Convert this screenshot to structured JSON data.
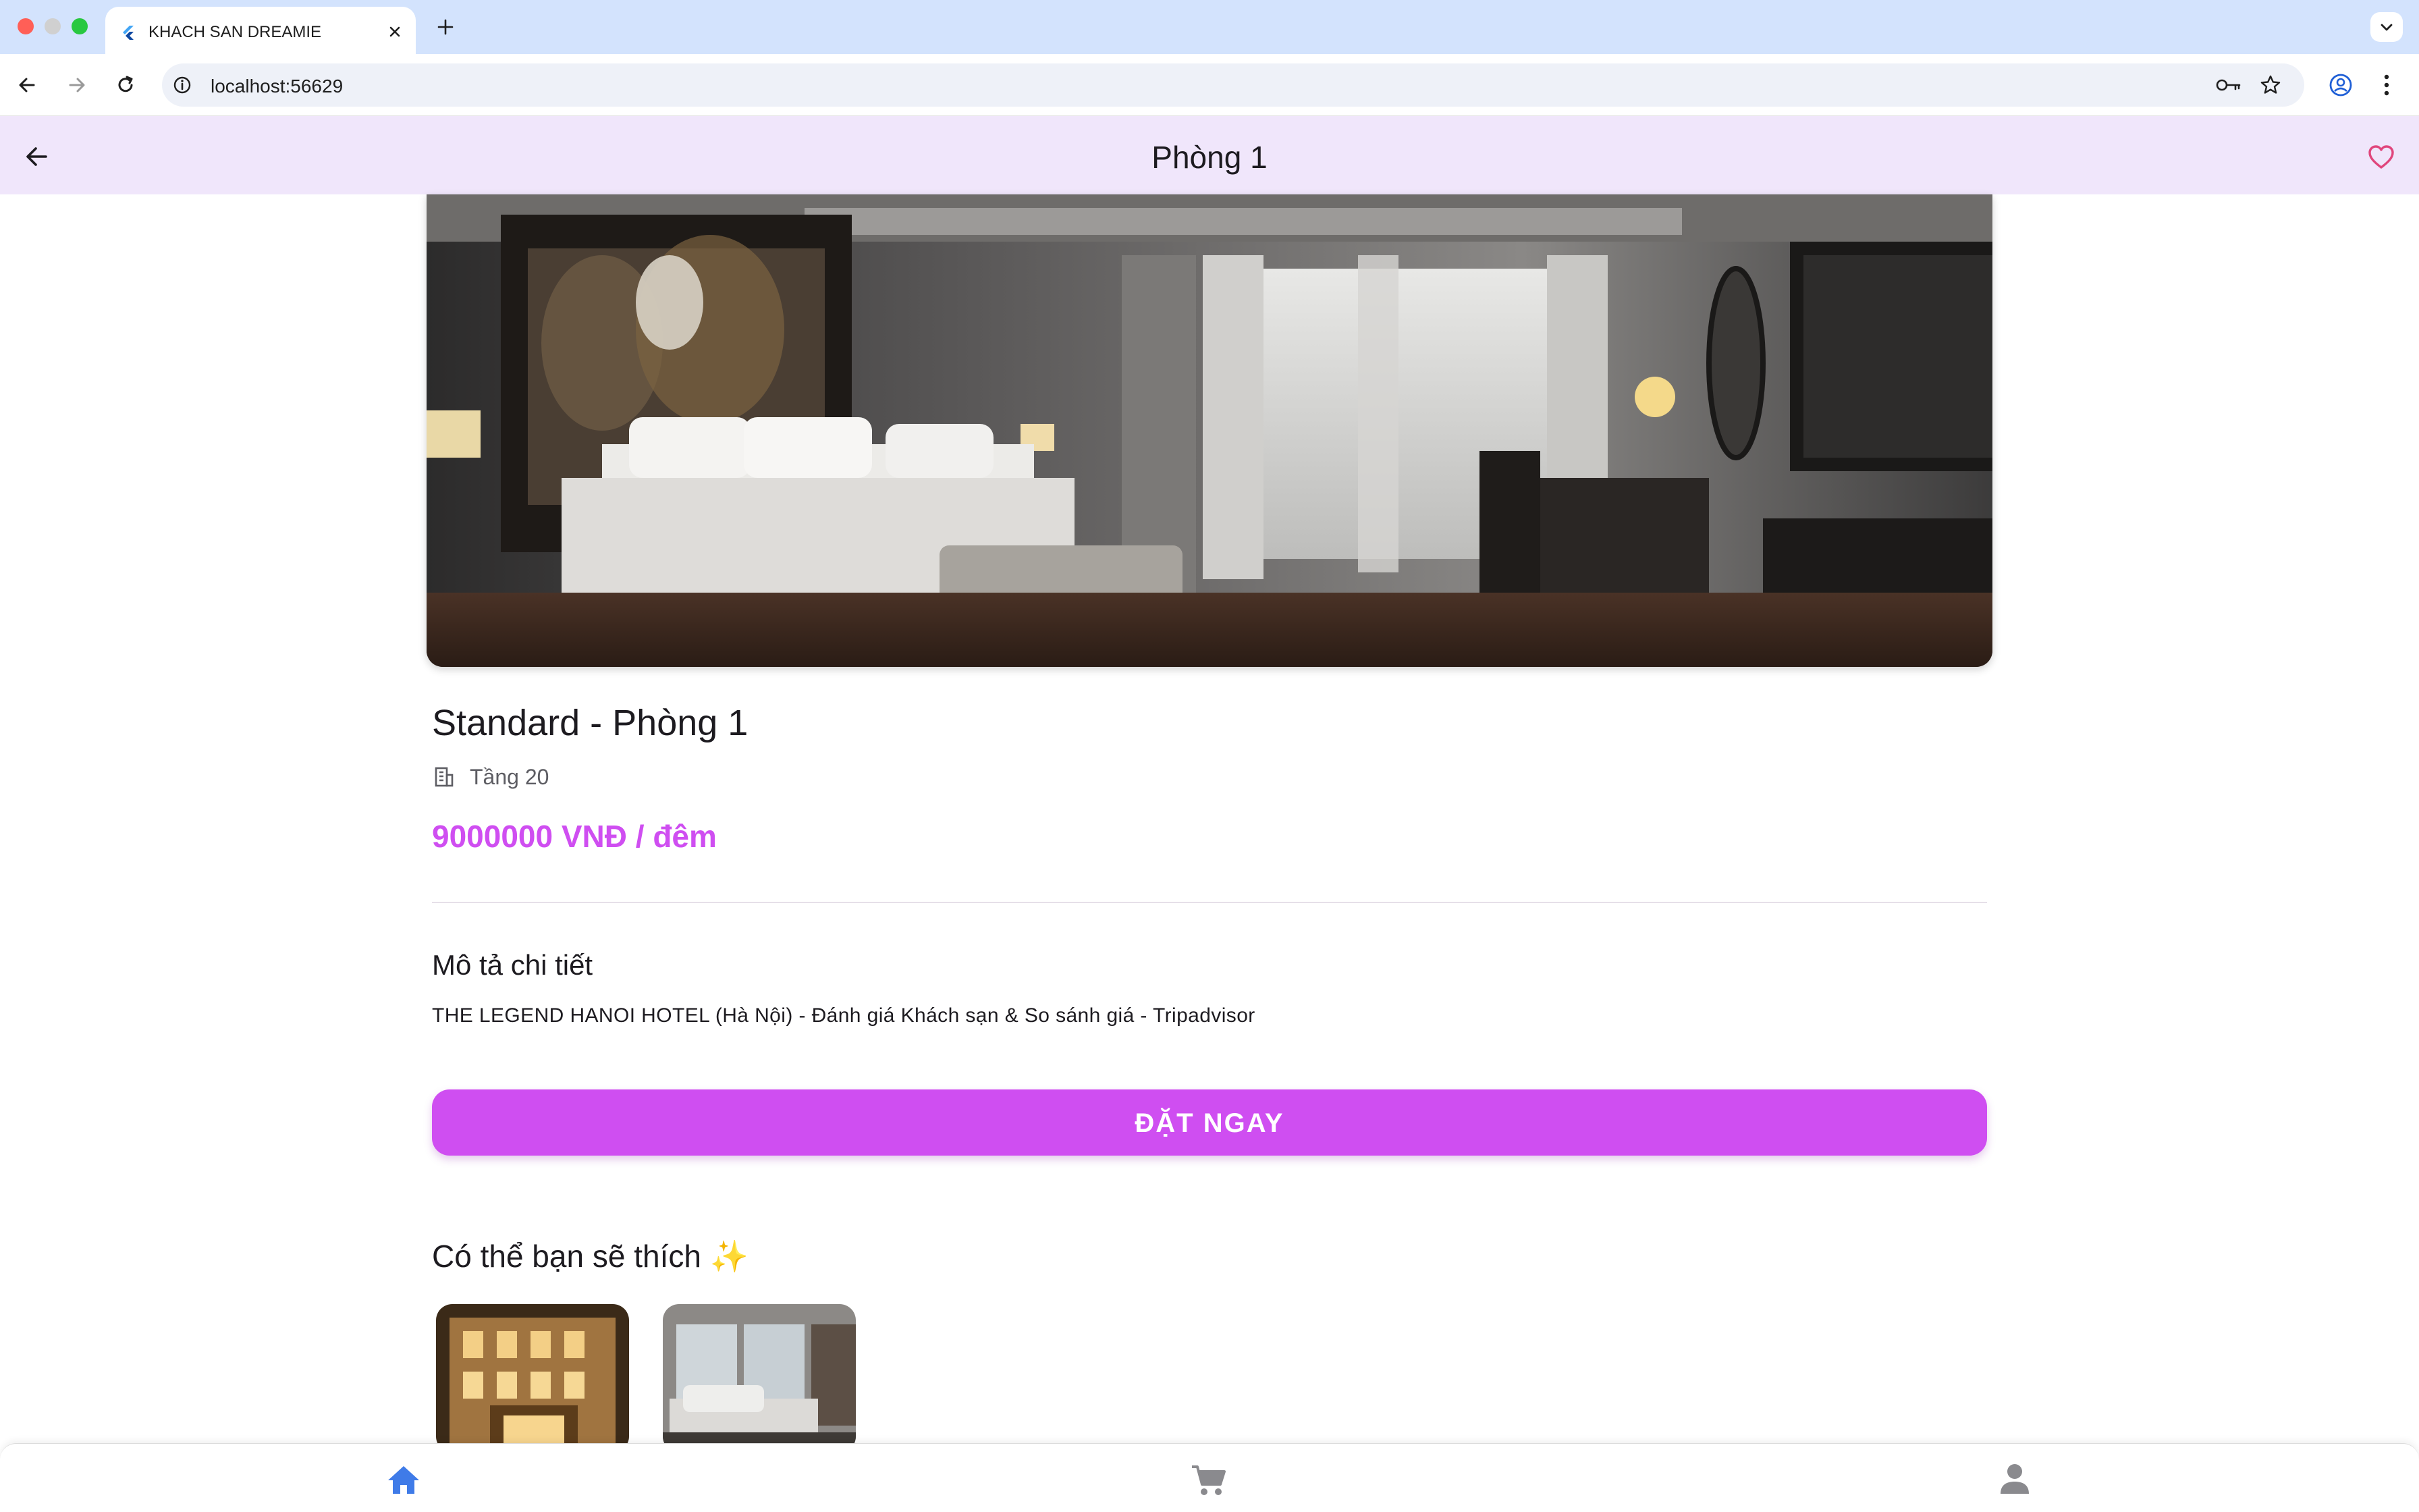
{
  "browser": {
    "tab_title": "KHACH SAN DREAMIE",
    "url": "localhost:56629"
  },
  "appbar": {
    "title": "Phòng 1"
  },
  "room": {
    "name": "Standard - Phòng 1",
    "floor": "Tầng 20",
    "price": "9000000 VNĐ / đêm"
  },
  "description": {
    "title": "Mô tả chi tiết",
    "text": "THE LEGEND HANOI HOTEL (Hà Nội) - Đánh giá Khách sạn & So sánh giá - Tripadvisor"
  },
  "book_button": {
    "label": "ĐẶT NGAY"
  },
  "recommendations": {
    "title": "Có thể bạn sẽ thích ✨"
  },
  "colors": {
    "accent": "#cf4ef1",
    "appbar_bg": "#f0e6fb",
    "nav_active": "#3f7be8",
    "nav_inactive": "#8a8a8e",
    "favorite": "#e0467c"
  },
  "bottom_nav": {
    "items": [
      {
        "icon": "home-icon",
        "active": true
      },
      {
        "icon": "cart-icon",
        "active": false
      },
      {
        "icon": "person-icon",
        "active": false
      }
    ]
  }
}
